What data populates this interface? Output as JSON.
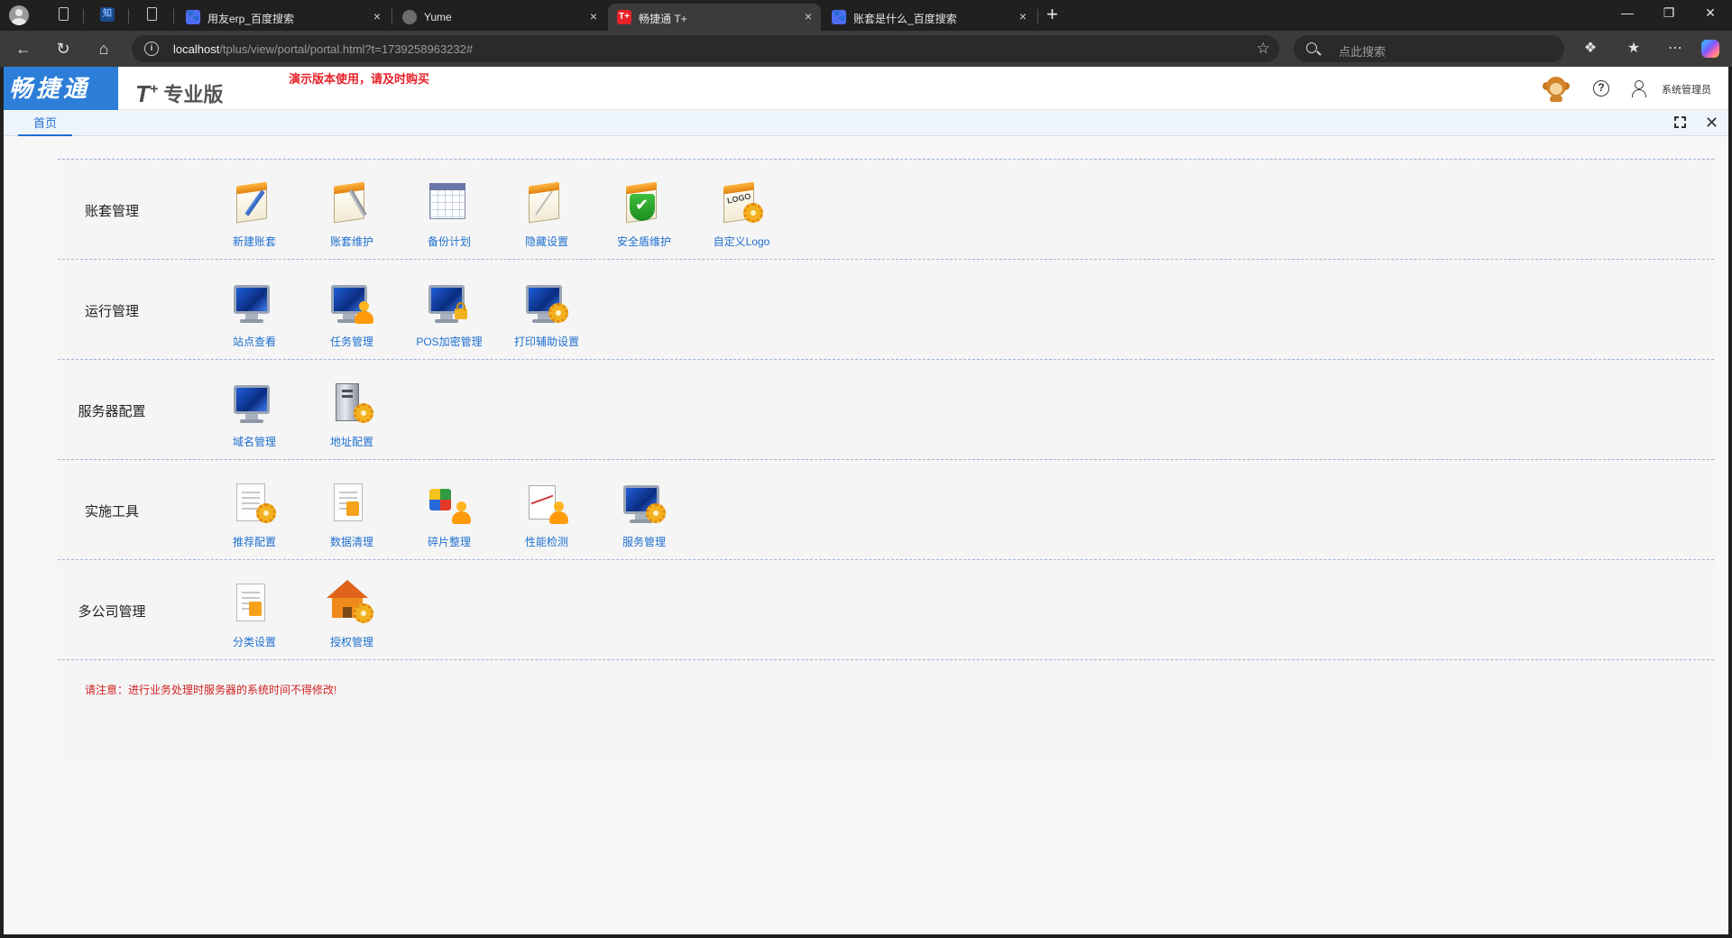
{
  "browser": {
    "tabs": [
      {
        "title": "用友erp_百度搜索",
        "active": false
      },
      {
        "title": "Yume",
        "active": false
      },
      {
        "title": "畅捷通 T+",
        "active": true
      },
      {
        "title": "账套是什么_百度搜索",
        "active": false
      }
    ],
    "pinned_tab_label": "知",
    "url_host": "localhost",
    "url_path": "/tplus/view/portal/portal.html?t=1739258963232#",
    "search_placeholder": "点此搜索",
    "close_glyph": "×",
    "new_tab_glyph": "+"
  },
  "app": {
    "brand": "畅捷通",
    "product_prefix": "T",
    "product_sup": "+",
    "product_edition": "专业版",
    "demo_notice": "演示版本使用，请及时购买",
    "user_name": "系统管理员",
    "home_tab": "首页"
  },
  "portal": {
    "sections": [
      {
        "title": "账套管理",
        "items": [
          {
            "label": "新建账套",
            "icon": "new-account-pad-icon"
          },
          {
            "label": "账套维护",
            "icon": "account-maintenance-icon"
          },
          {
            "label": "备份计划",
            "icon": "backup-calendar-icon"
          },
          {
            "label": "隐藏设置",
            "icon": "hidden-settings-icon"
          },
          {
            "label": "安全盾维护",
            "icon": "security-shield-icon"
          },
          {
            "label": "自定义Logo",
            "icon": "custom-logo-icon"
          }
        ]
      },
      {
        "title": "运行管理",
        "items": [
          {
            "label": "站点查看",
            "icon": "site-monitor-icon"
          },
          {
            "label": "任务管理",
            "icon": "task-monitor-person-icon"
          },
          {
            "label": "POS加密管理",
            "icon": "pos-encrypt-lock-icon"
          },
          {
            "label": "打印辅助设置",
            "icon": "print-assist-gear-icon"
          }
        ]
      },
      {
        "title": "服务器配置",
        "items": [
          {
            "label": "域名管理",
            "icon": "domain-monitor-icon"
          },
          {
            "label": "地址配置",
            "icon": "server-tower-gear-icon"
          }
        ]
      },
      {
        "title": "实施工具",
        "items": [
          {
            "label": "推荐配置",
            "icon": "recommend-doc-gear-icon"
          },
          {
            "label": "数据清理",
            "icon": "data-clean-doc-icon"
          },
          {
            "label": "碎片整理",
            "icon": "defrag-puzzle-icon"
          },
          {
            "label": "性能检测",
            "icon": "performance-chart-icon"
          },
          {
            "label": "服务管理",
            "icon": "service-monitor-gear-icon"
          }
        ]
      },
      {
        "title": "多公司管理",
        "items": [
          {
            "label": "分类设置",
            "icon": "category-doc-icon"
          },
          {
            "label": "授权管理",
            "icon": "authorization-house-gear-icon"
          }
        ]
      }
    ],
    "warning": "请注意：进行业务处理时服务器的系统时间不得修改!"
  },
  "colors": {
    "brand": "#2d7ed8",
    "link": "#1e6fd0",
    "warning": "#d02020"
  }
}
